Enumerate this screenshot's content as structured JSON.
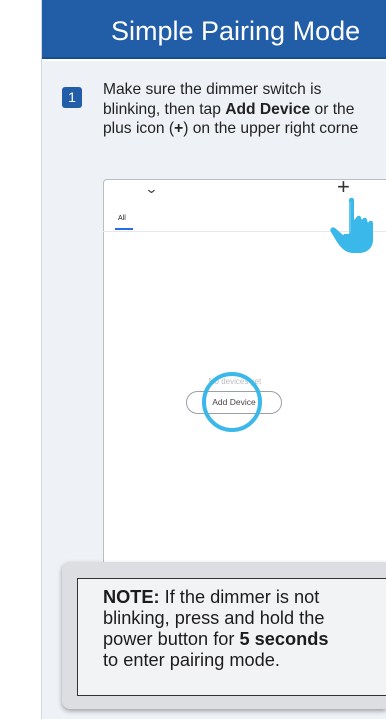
{
  "header": {
    "title": "Simple Pairing Mode"
  },
  "step": {
    "number": "1",
    "line1": "Make sure the dimmer switch is",
    "line2_a": "blinking, then tap ",
    "line2_bold": "Add Device",
    "line2_b": " or the",
    "line3_a": "plus icon (",
    "line3_bold": "+",
    "line3_b": ") on the upper right corne"
  },
  "phone": {
    "tab_label": "All",
    "empty_text": "No devices yet",
    "add_button": "Add Device",
    "plus_symbol": "+",
    "chevron": "⌄"
  },
  "note": {
    "bold_label": "NOTE:",
    "line1_rest": " If the dimmer is not",
    "line2": "blinking, press and hold the",
    "line3_a": "power button for ",
    "line3_bold": "5 seconds",
    "line4": "to enter pairing mode."
  },
  "colors": {
    "header_blue": "#225ea7",
    "highlight_cyan": "#3bb8ea",
    "panel_bg": "#eef1f6"
  },
  "icons": [
    "chevron-down-icon",
    "plus-icon",
    "tap-hand-icon"
  ]
}
